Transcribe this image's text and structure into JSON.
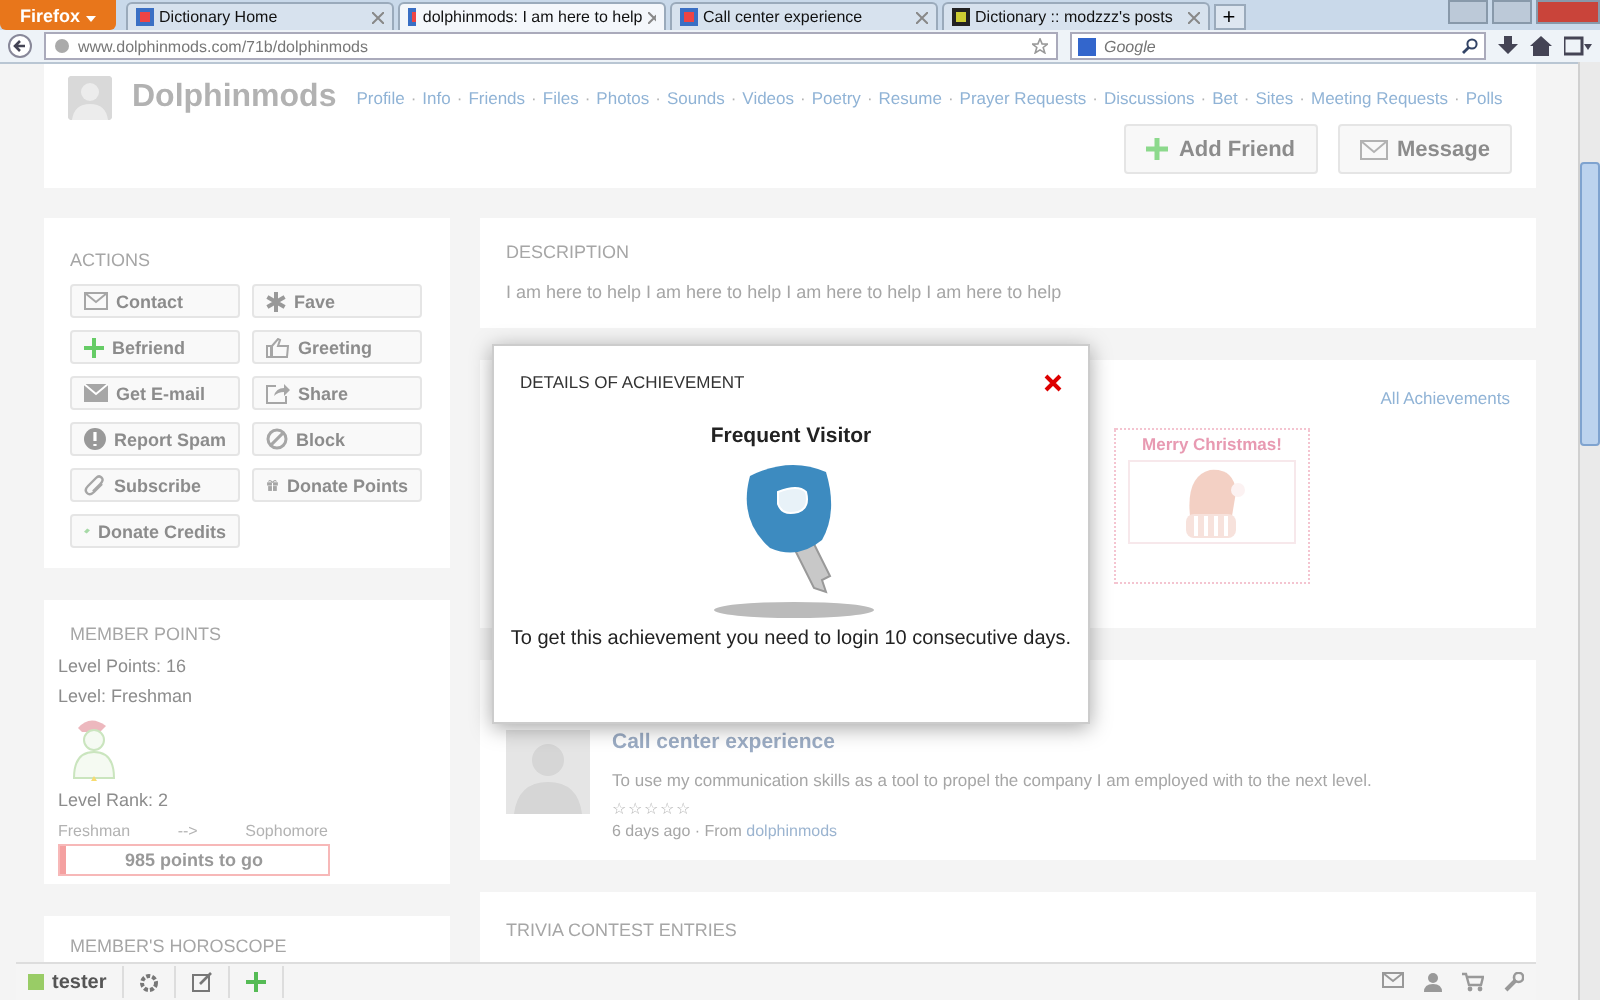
{
  "browser": {
    "menu_button": "Firefox",
    "tabs": [
      {
        "label": "Dictionary Home",
        "selected": false
      },
      {
        "label": "dolphinmods: I am here to help",
        "selected": true
      },
      {
        "label": "Call center experience",
        "selected": false
      },
      {
        "label": "Dictionary :: modzzz's posts",
        "selected": false
      }
    ],
    "new_tab": "+",
    "address": "www.dolphinmods.com/71b/dolphinmods",
    "search": {
      "placeholder": "Google"
    }
  },
  "profile": {
    "name": "Dolphinmods",
    "nav": [
      "Profile",
      "Info",
      "Friends",
      "Files",
      "Photos",
      "Sounds",
      "Videos",
      "Poetry",
      "Resume",
      "Prayer Requests",
      "Discussions",
      "Bet",
      "Sites",
      "Meeting Requests",
      "Polls"
    ],
    "nav_separator": "·",
    "buttons": [
      "Add Friend",
      "Message"
    ]
  },
  "actions": {
    "title": "ACTIONS",
    "buttons": [
      "Contact",
      "Fave",
      "Befriend",
      "Greeting",
      "Get E-mail",
      "Share",
      "Report Spam",
      "Block",
      "Subscribe",
      "Donate Points",
      "Donate Credits"
    ]
  },
  "member_points": {
    "title": "MEMBER POINTS",
    "lines": [
      "Level Points: 16",
      "Level: Freshman"
    ],
    "rank": "Level Rank: 2",
    "from": "Freshman",
    "arrow": "-->",
    "to": "Sophomore",
    "progress": {
      "label": "985 points to go",
      "level": 0.02
    }
  },
  "horoscope": {
    "title": "MEMBER'S HOROSCOPE"
  },
  "description": {
    "title": "DESCRIPTION",
    "text": "I am here to help I am here to help I am here to help I am here to help"
  },
  "achievements": {
    "link": "All Achievements",
    "items": [
      {
        "title": "Merry Christmas!"
      }
    ]
  },
  "post": {
    "title": "Call center experience",
    "text": "To use my communication skills as a tool to propel the company I am employed with to the next level.",
    "stars": 0,
    "age": "6 days ago · From",
    "author": "dolphinmods"
  },
  "trivia": {
    "title": "TRIVIA CONTEST ENTRIES"
  },
  "bottom_bar": {
    "user": "tester"
  },
  "modal": {
    "title": "DETAILS OF ACHIEVEMENT",
    "name": "Frequent Visitor",
    "text": "To get this achievement you need to login 10 consecutive days."
  }
}
